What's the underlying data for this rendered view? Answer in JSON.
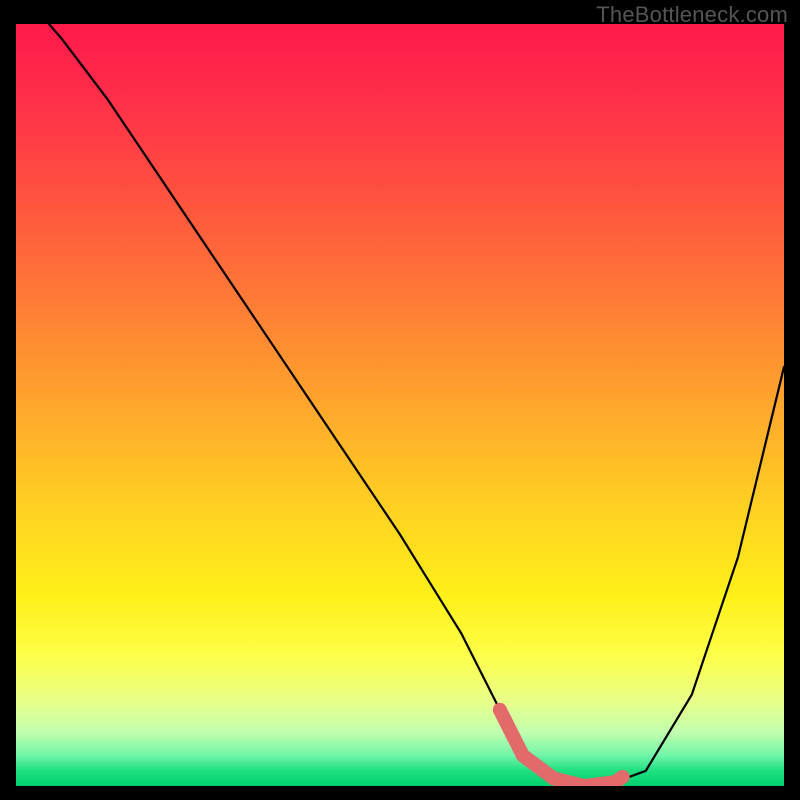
{
  "watermark": "TheBottleneck.com",
  "chart_data": {
    "type": "line",
    "title": "",
    "xlabel": "",
    "ylabel": "",
    "xlim": [
      0,
      100
    ],
    "ylim": [
      0,
      100
    ],
    "series": [
      {
        "name": "bottleneck-curve",
        "x": [
          0,
          6,
          12,
          20,
          30,
          40,
          50,
          58,
          63,
          66,
          70,
          74,
          78,
          82,
          88,
          94,
          100
        ],
        "values": [
          105,
          98,
          90,
          78,
          63,
          48,
          33,
          20,
          10,
          4,
          1,
          0,
          0.5,
          2,
          12,
          30,
          55
        ]
      }
    ],
    "marker_segment": {
      "name": "optimal-range",
      "x": [
        63,
        66,
        70,
        74,
        78,
        79
      ],
      "values": [
        10,
        4,
        1,
        0,
        0.5,
        1.2
      ]
    },
    "colors": {
      "curve": "#000000",
      "marker": "#e26a6a",
      "gradient_top": "#ff1a4a",
      "gradient_mid": "#ffe018",
      "gradient_bottom": "#00d070"
    }
  }
}
